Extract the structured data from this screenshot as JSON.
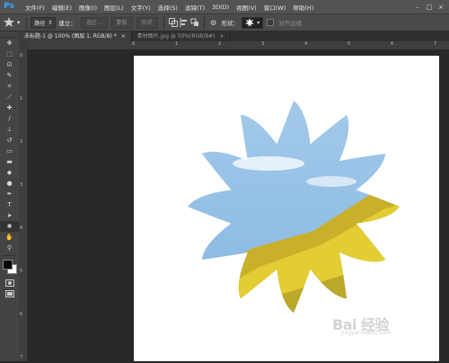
{
  "app": {
    "logo": "Ps"
  },
  "menu": [
    "文件(F)",
    "编辑(E)",
    "图像(I)",
    "图层(L)",
    "文字(Y)",
    "选择(S)",
    "滤镜(T)",
    "3D(D)",
    "视图(V)",
    "窗口(W)",
    "帮助(H)"
  ],
  "window_controls": [
    "–",
    "□",
    "×"
  ],
  "options": {
    "mode_value": "路径",
    "build_label": "建立：",
    "selection_button": "选区...",
    "mask_button": "蒙版",
    "shape_button": "形状",
    "shape_label": "形状：",
    "align_edges_label": "对齐边缘"
  },
  "tabs": [
    {
      "label": "未标题-1 @ 100% (图层 1, RGB/8) *",
      "close": "×",
      "active": true
    },
    {
      "label": "素材图片.jpg @ 50%(RGB/8#)",
      "close": "×",
      "active": false
    }
  ],
  "ruler_top_labels": [
    "0",
    "1",
    "2",
    "3",
    "4",
    "5",
    "6",
    "7"
  ],
  "ruler_left_labels": [
    "0",
    "1",
    "2",
    "3",
    "4",
    "5",
    "6",
    "7"
  ],
  "tools": [
    {
      "name": "move-tool",
      "glyph": "✥"
    },
    {
      "name": "marquee-tool",
      "glyph": "⬚"
    },
    {
      "name": "lasso-tool",
      "glyph": "ᘏ"
    },
    {
      "name": "quick-select-tool",
      "glyph": "✎"
    },
    {
      "name": "crop-tool",
      "glyph": "⌗"
    },
    {
      "name": "eyedropper-tool",
      "glyph": "⟋"
    },
    {
      "name": "healing-tool",
      "glyph": "✚"
    },
    {
      "name": "brush-tool",
      "glyph": "∕"
    },
    {
      "name": "stamp-tool",
      "glyph": "⊥"
    },
    {
      "name": "history-brush-tool",
      "glyph": "↺"
    },
    {
      "name": "eraser-tool",
      "glyph": "▭"
    },
    {
      "name": "gradient-tool",
      "glyph": "▬"
    },
    {
      "name": "blur-tool",
      "glyph": "◆"
    },
    {
      "name": "dodge-tool",
      "glyph": "●"
    },
    {
      "name": "pen-tool",
      "glyph": "✒"
    },
    {
      "name": "type-tool",
      "glyph": "T"
    },
    {
      "name": "path-select-tool",
      "glyph": "➤"
    },
    {
      "name": "shape-tool",
      "glyph": "✺"
    },
    {
      "name": "hand-tool",
      "glyph": "✋"
    },
    {
      "name": "zoom-tool",
      "glyph": "⚲"
    }
  ],
  "selected_tool": "shape-tool",
  "colors": {
    "foreground": "#000000",
    "background": "#ffffff",
    "sky": "#8fc1e8",
    "field": "#d9c52b"
  },
  "watermark": {
    "brand": "Bai 经验",
    "url": "jingyan.baidu.com"
  }
}
